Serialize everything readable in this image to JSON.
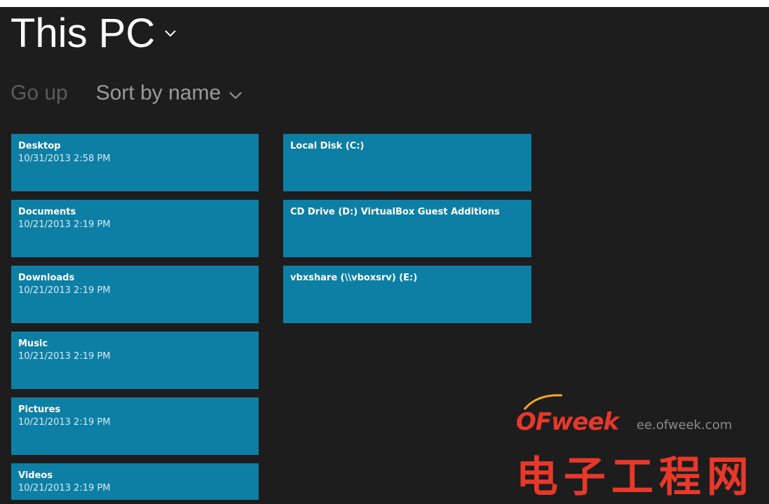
{
  "header": {
    "title": "This PC",
    "title_dropdown_icon": "chevron-down-icon"
  },
  "commands": {
    "go_up": "Go up",
    "sort_by": "Sort by name",
    "sort_icon": "chevron-down-icon"
  },
  "folders": [
    {
      "name": "Desktop",
      "date": "10/31/2013 2:58 PM"
    },
    {
      "name": "Documents",
      "date": "10/21/2013 2:19 PM"
    },
    {
      "name": "Downloads",
      "date": "10/21/2013 2:19 PM"
    },
    {
      "name": "Music",
      "date": "10/21/2013 2:19 PM"
    },
    {
      "name": "Pictures",
      "date": "10/21/2013 2:19 PM"
    },
    {
      "name": "Videos",
      "date": "10/21/2013 2:19 PM"
    }
  ],
  "drives": [
    {
      "name": "Local Disk (C:)"
    },
    {
      "name": "CD Drive (D:) VirtualBox Guest Additions"
    },
    {
      "name": "vbxshare (\\\\vboxsrv) (E:)"
    }
  ],
  "watermark": {
    "brand": "OFweek",
    "url": "ee.ofweek.com",
    "chinese": "电子工程网"
  },
  "colors": {
    "background": "#1d1d1d",
    "tile": "#0e7fa4",
    "watermark_red": "#e8382a"
  }
}
